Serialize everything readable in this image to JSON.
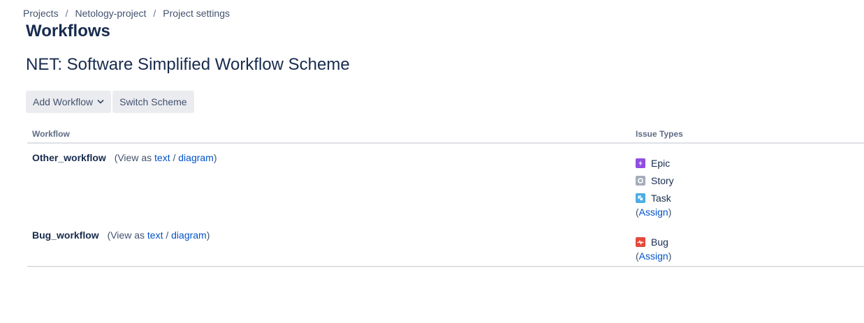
{
  "breadcrumb": {
    "items": [
      "Projects",
      "Netology-project",
      "Project settings"
    ],
    "separator": "/"
  },
  "page_title": "Workflows",
  "scheme_title": "NET: Software Simplified Workflow Scheme",
  "toolbar": {
    "add_workflow_label": "Add Workflow",
    "switch_scheme_label": "Switch Scheme"
  },
  "table": {
    "headers": {
      "workflow": "Workflow",
      "issue_types": "Issue Types"
    },
    "view_as_prefix": "(View as",
    "text_link": "text",
    "slash": "/",
    "diagram_link": "diagram",
    "close_paren": ")",
    "assign_label": "Assign",
    "open_paren": "(",
    "rows": [
      {
        "workflow": "Other_workflow",
        "issue_types": [
          {
            "name": "Epic",
            "icon": "epic-icon",
            "color": "#904ee2"
          },
          {
            "name": "Story",
            "icon": "story-icon",
            "color": "#a5adba"
          },
          {
            "name": "Task",
            "icon": "task-icon",
            "color": "#4bade8"
          }
        ]
      },
      {
        "workflow": "Bug_workflow",
        "issue_types": [
          {
            "name": "Bug",
            "icon": "bug-icon",
            "color": "#e5493a"
          }
        ]
      }
    ]
  }
}
